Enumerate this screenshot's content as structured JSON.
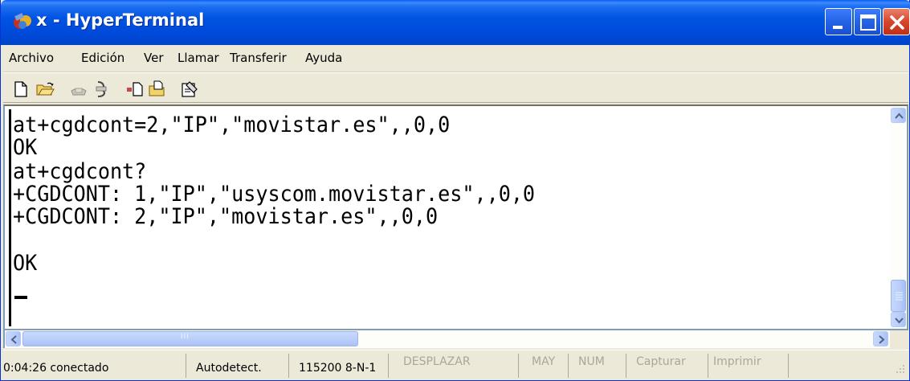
{
  "window": {
    "title": "x - HyperTerminal"
  },
  "menu": [
    "Archivo",
    "Edición",
    "Ver",
    "Llamar",
    "Transferir",
    "Ayuda"
  ],
  "toolbar": {
    "buttons": [
      "new-icon",
      "open-icon",
      "call-icon",
      "disconnect-icon",
      "send-icon",
      "receive-icon",
      "properties-icon"
    ]
  },
  "terminal": {
    "lines": [
      "at+cgdcont=2,\"IP\",\"movistar.es\",,0,0",
      "OK",
      "at+cgdcont?",
      "+CGDCONT: 1,\"IP\",\"usyscom.movistar.es\",,0,0",
      "+CGDCONT: 2,\"IP\",\"movistar.es\",,0,0",
      "",
      "OK"
    ]
  },
  "scrollbar": {
    "horizontal_grip": "III"
  },
  "status": {
    "connection": "0:04:26 conectado",
    "detect": "Autodetect.",
    "port": "115200 8-N-1",
    "scroll": "DESPLAZAR",
    "caps": "MAY",
    "num": "NUM",
    "capture": "Capturar",
    "print": "Imprimir"
  },
  "colors": {
    "titlebar": "#0054e3",
    "close": "#d8452b",
    "chrome": "#ece9d8"
  }
}
